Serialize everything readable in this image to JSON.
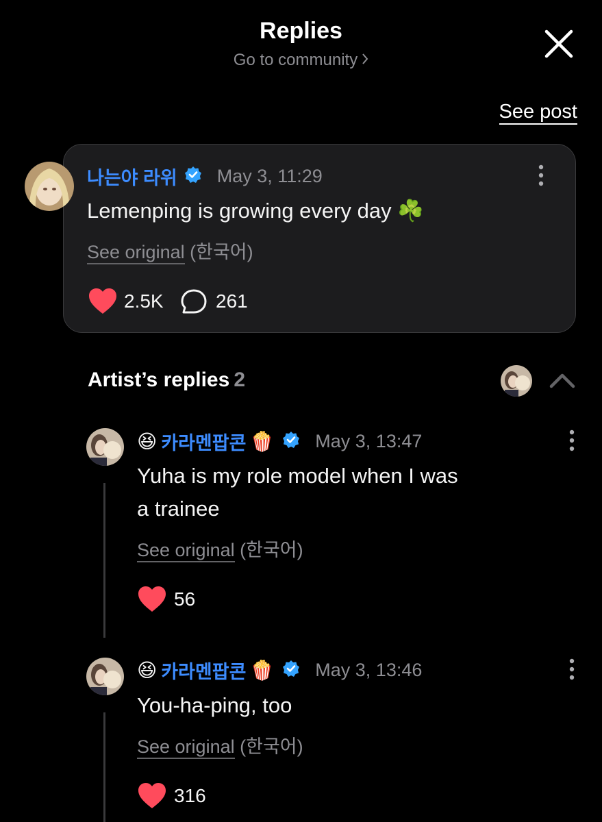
{
  "header": {
    "title": "Replies",
    "subtitle": "Go to community",
    "see_post_label": "See post"
  },
  "post": {
    "author": "나는야 라위",
    "timestamp": "May 3, 11:29",
    "text": "Lemenping is growing every day ☘️",
    "see_original_label": "See original",
    "language": "(한국어)",
    "likes": "2.5K",
    "comments": "261"
  },
  "artist_replies": {
    "title": "Artist’s replies",
    "count": "2",
    "replies": [
      {
        "author": "카라멘팝콘",
        "author_prefix_emoji": "😆",
        "author_suffix_emoji": "🍿",
        "timestamp": "May 3, 13:47",
        "text_line1": "Yuha is my role model when I was",
        "text_line2": "a trainee",
        "see_original_label": "See original",
        "language": "(한국어)",
        "likes": "56"
      },
      {
        "author": "카라멘팝콘",
        "author_prefix_emoji": "😆",
        "author_suffix_emoji": "🍿",
        "timestamp": "May 3, 13:46",
        "text_line1": "You-ha-ping, too",
        "see_original_label": "See original",
        "language": "(한국어)",
        "likes": "316"
      }
    ]
  },
  "colors": {
    "background": "#000000",
    "card": "#1c1c1e",
    "accent_name": "#3d8cff",
    "verified": "#34a3ff",
    "heart": "#ff4b5c",
    "muted": "#8e8e93"
  },
  "icons": [
    "close-icon",
    "chevron-right-icon",
    "verified-badge-icon",
    "more-vertical-icon",
    "heart-icon",
    "comment-icon",
    "chevron-up-icon"
  ]
}
